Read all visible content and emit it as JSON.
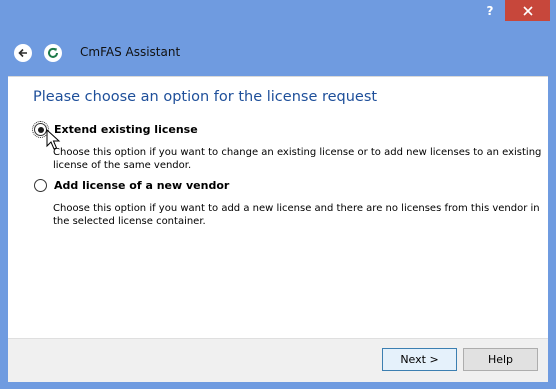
{
  "window": {
    "help_caption": "?",
    "app_title": "CmFAS Assistant"
  },
  "main": {
    "heading": "Please choose an option for the license request",
    "options": [
      {
        "label": "Extend existing license",
        "description": "Choose this option if you want to change an existing license or to add new licenses to an existing license of the same vendor.",
        "selected": true
      },
      {
        "label": "Add license of a new vendor",
        "description": "Choose this option if you want to add a new license and there are no licenses from this vendor in the selected license container.",
        "selected": false
      }
    ]
  },
  "footer": {
    "next_label": "Next >",
    "help_label": "Help"
  },
  "colors": {
    "title_bar": "#6f9be0",
    "close_button": "#c7473b",
    "heading_text": "#1e4f9a"
  },
  "icons": {
    "back": "back-arrow-icon",
    "app": "refresh-icon",
    "close": "close-icon"
  }
}
